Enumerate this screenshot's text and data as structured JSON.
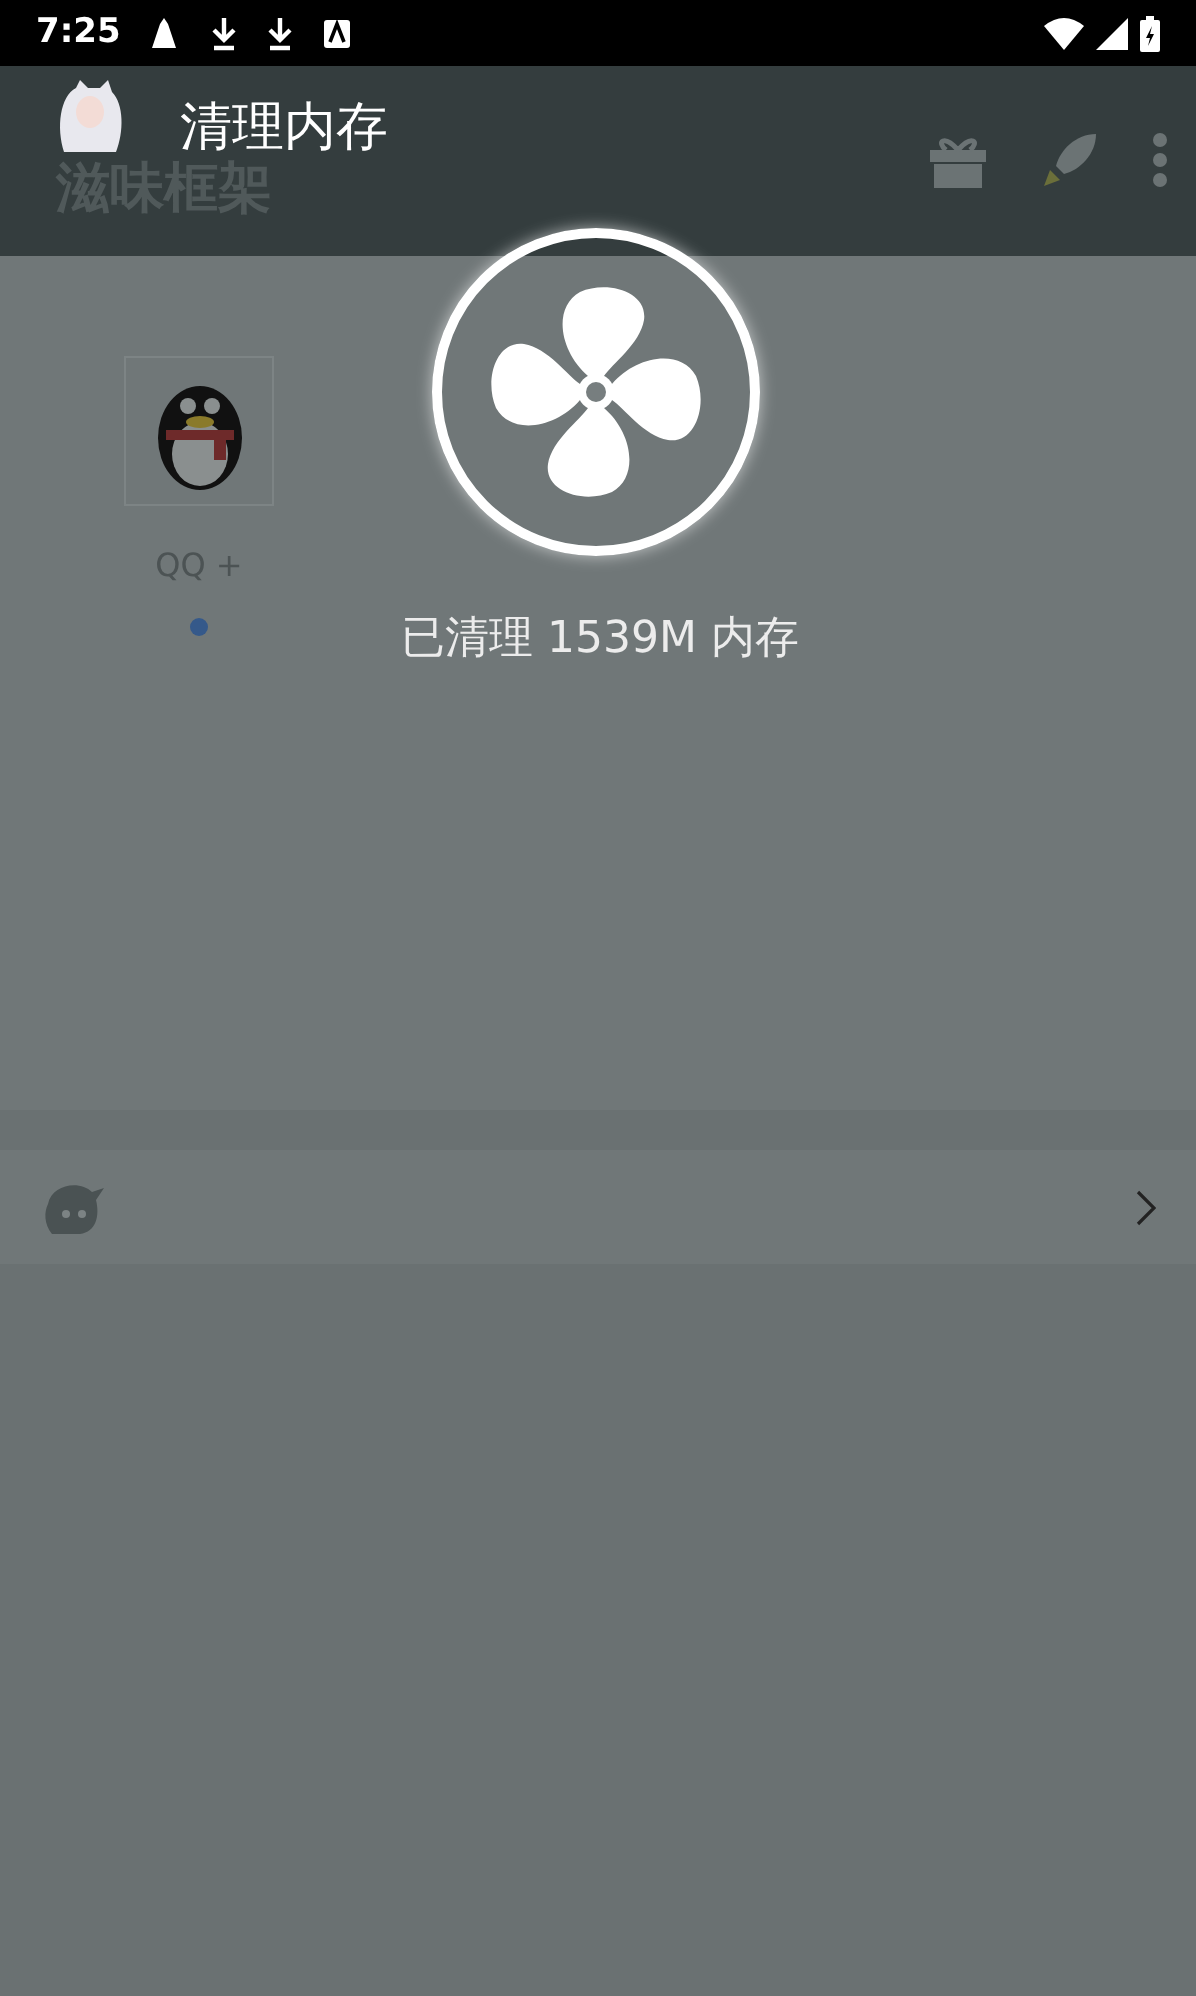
{
  "status_bar": {
    "time": "7:25"
  },
  "app_bar": {
    "title": "滋味框架"
  },
  "apps": [
    {
      "label": "QQ +"
    }
  ],
  "cleaner_overlay": {
    "title": "清理内存",
    "message": "已清理 1539M 内存"
  }
}
